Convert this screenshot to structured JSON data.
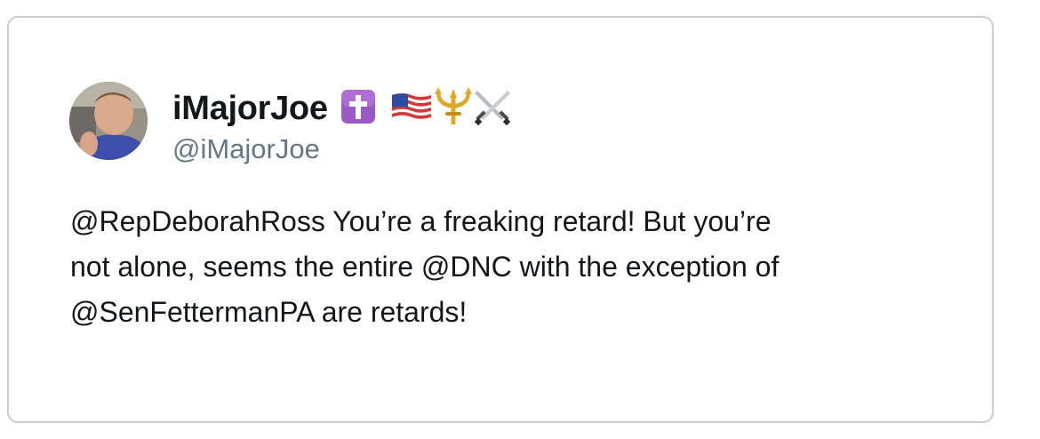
{
  "tweet": {
    "display_name": "iMajorJoe",
    "name_emoji": [
      {
        "name": "latin-cross-emoji",
        "char": "✝️"
      },
      {
        "name": "us-flag-emoji",
        "char": "🇺🇸"
      },
      {
        "name": "trident-emoji",
        "char": "🔱"
      },
      {
        "name": "crossed-swords-emoji",
        "char": "⚔️"
      }
    ],
    "handle": "@iMajorJoe",
    "text": "@RepDeborahRoss You’re a freaking retard! But you’re\nnot alone, seems the entire @DNC with the exception of\n@SenFettermanPA are retards!"
  },
  "colors": {
    "border": "#c9ced4",
    "name": "#14171a",
    "handle": "#657786",
    "cross_badge": "#9b59c6",
    "trident_gold": "#e0a82a"
  }
}
